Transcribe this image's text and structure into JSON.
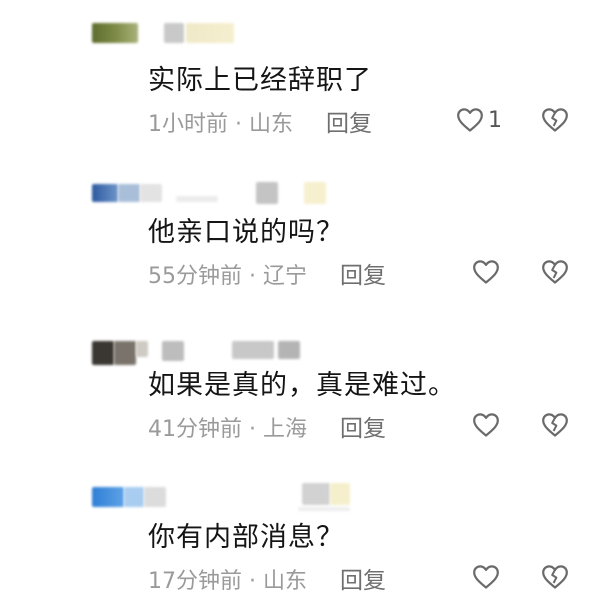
{
  "comments": [
    {
      "text": "实际上已经辞职了",
      "time": "1小时前",
      "dot": "·",
      "location": "山东",
      "reply_label": "回复",
      "like_count": "1"
    },
    {
      "text": "他亲口说的吗？",
      "time": "55分钟前",
      "dot": "·",
      "location": "辽宁",
      "reply_label": "回复",
      "like_count": ""
    },
    {
      "text": "如果是真的，真是难过。",
      "time": "41分钟前",
      "dot": "·",
      "location": "上海",
      "reply_label": "回复",
      "like_count": ""
    },
    {
      "text": "你有内部消息？",
      "time": "17分钟前",
      "dot": "·",
      "location": "山东",
      "reply_label": "回复",
      "like_count": ""
    }
  ],
  "icons": {
    "like": "heart-outline-icon",
    "dislike": "broken-heart-icon"
  },
  "colors": {
    "text": "#151515",
    "meta": "#9a9a9a",
    "reply": "#6f6f6f",
    "icon": "#6a6a6a"
  }
}
